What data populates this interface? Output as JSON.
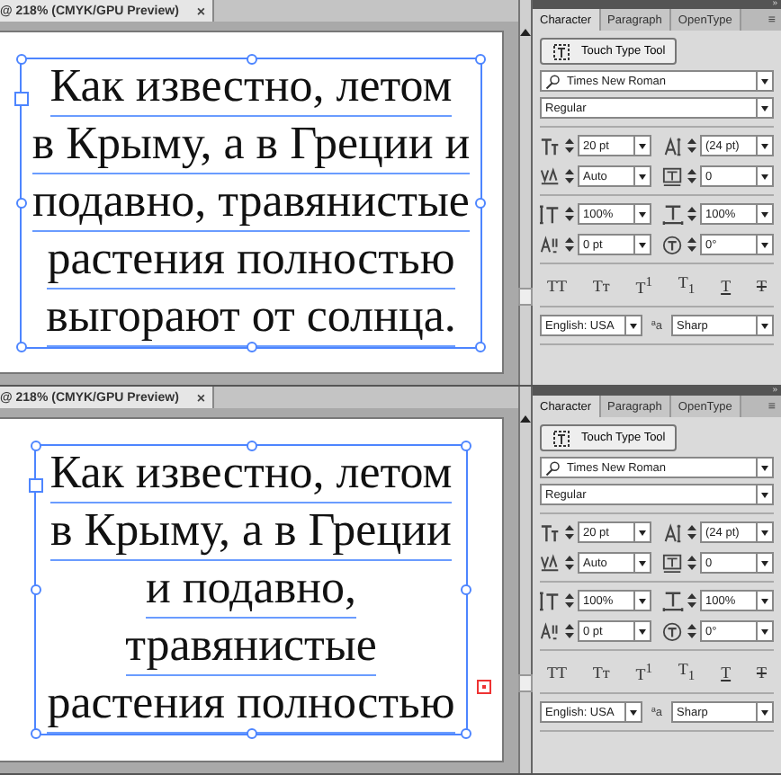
{
  "panes": [
    {
      "document_tab": {
        "title": "@ 218% (CMYK/GPU Preview)",
        "close": "×"
      },
      "text_frame": {
        "selected": true,
        "overflow": false,
        "lines": [
          "Как известно, летом",
          "в Крыму, а в Греции и",
          "подавно, травянистые",
          "растения полностью",
          "выгорают от солнца."
        ]
      },
      "panel": {
        "collapse": "»",
        "menu": "≡",
        "tabs": [
          {
            "label": "Character",
            "selected": true
          },
          {
            "label": "Paragraph",
            "selected": false
          },
          {
            "label": "OpenType",
            "selected": false
          }
        ],
        "touch_type_button": "Touch Type Tool",
        "font_family": "Times New Roman",
        "font_style": "Regular",
        "fields": [
          {
            "kind": "size",
            "value": "20 pt"
          },
          {
            "kind": "leading",
            "value": "(24 pt)"
          },
          {
            "kind": "kerning",
            "value": "Auto"
          },
          {
            "kind": "tracking",
            "value": "0"
          },
          {
            "kind": "vscale",
            "value": "100%"
          },
          {
            "kind": "hscale",
            "value": "100%"
          },
          {
            "kind": "baseline",
            "value": "0 pt"
          },
          {
            "kind": "rotation",
            "value": "0°"
          }
        ],
        "style_buttons": [
          {
            "label": "TT",
            "kind": "plain"
          },
          {
            "label": "Tт",
            "kind": "plain"
          },
          {
            "label": "T$^{1}$",
            "kind": "rich"
          },
          {
            "label": "T$_{1}$",
            "kind": "rich"
          },
          {
            "label": "T",
            "kind": "underline"
          },
          {
            "label": "T",
            "kind": "strike"
          }
        ],
        "language": "English: USA",
        "antialias_icon": "ªa",
        "antialias": "Sharp"
      }
    },
    {
      "document_tab": {
        "title": "@ 218% (CMYK/GPU Preview)",
        "close": "×"
      },
      "text_frame": {
        "selected": true,
        "overflow": true,
        "lines": [
          "Как известно, летом",
          "в Крыму, а в Греции",
          "и подавно,",
          "травянистые",
          "растения полностью"
        ]
      },
      "panel": {
        "collapse": "»",
        "menu": "≡",
        "tabs": [
          {
            "label": "Character",
            "selected": true
          },
          {
            "label": "Paragraph",
            "selected": false
          },
          {
            "label": "OpenType",
            "selected": false
          }
        ],
        "touch_type_button": "Touch Type Tool",
        "font_family": "Times New Roman",
        "font_style": "Regular",
        "fields": [
          {
            "kind": "size",
            "value": "20 pt"
          },
          {
            "kind": "leading",
            "value": "(24 pt)"
          },
          {
            "kind": "kerning",
            "value": "Auto"
          },
          {
            "kind": "tracking",
            "value": "0"
          },
          {
            "kind": "vscale",
            "value": "100%"
          },
          {
            "kind": "hscale",
            "value": "100%"
          },
          {
            "kind": "baseline",
            "value": "0 pt"
          },
          {
            "kind": "rotation",
            "value": "0°"
          }
        ],
        "style_buttons": [
          {
            "label": "TT",
            "kind": "plain"
          },
          {
            "label": "Tт",
            "kind": "plain"
          },
          {
            "label": "T$^{1}$",
            "kind": "rich"
          },
          {
            "label": "T$_{1}$",
            "kind": "rich"
          },
          {
            "label": "T",
            "kind": "underline"
          },
          {
            "label": "T",
            "kind": "strike"
          }
        ],
        "language": "English: USA",
        "antialias_icon": "ªa",
        "antialias": "Sharp"
      }
    }
  ]
}
